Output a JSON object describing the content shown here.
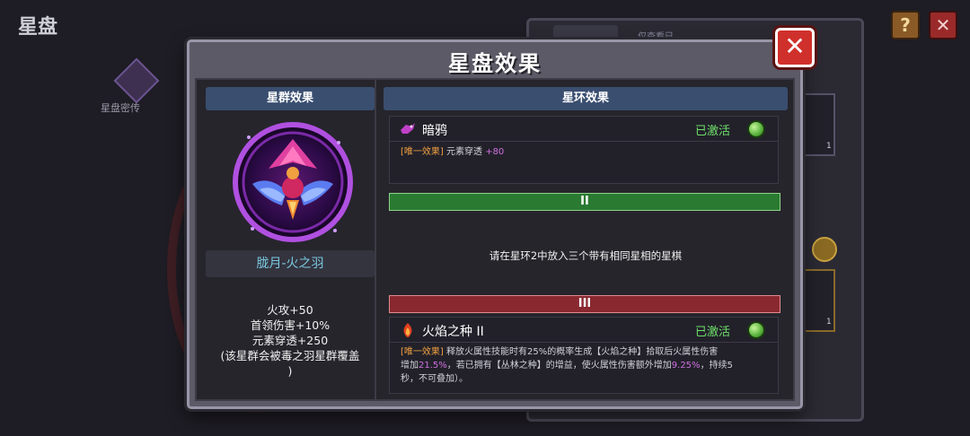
{
  "background": {
    "screen_title": "星盘",
    "help_label": "?",
    "close_label": "✕",
    "side_label": "星盘密传",
    "tab_a": "",
    "tab_b": "仅查看已",
    "slot_count_1": "1",
    "slot_count_2": "1"
  },
  "dialog": {
    "title": "星盘效果",
    "close_label": "✕",
    "left": {
      "header": "星群效果",
      "constellation_name": "胧月-火之羽",
      "bonuses": [
        "火攻+50",
        "首领伤害+10%",
        "元素穿透+250",
        "(该星群会被毒之羽星群覆盖",
        ")"
      ]
    },
    "right": {
      "header": "星环效果",
      "ring1": {
        "name": "暗鸦",
        "status": "已激活",
        "effect_tag": "[唯一效果]",
        "effect_text": "元素穿透",
        "effect_value": "+80"
      },
      "tier2_label": "II",
      "tier2_hint": "请在星环2中放入三个带有相同星相的星棋",
      "tier3_label": "III",
      "ring3": {
        "name": "火焰之种 II",
        "status": "已激活",
        "effect_tag": "[唯一效果]",
        "effect_part1": "释放火属性技能时有25%的概率生成【火焰之种】拾取后火属性伤害",
        "effect_part2": "增加",
        "effect_val1": "21.5%",
        "effect_part3": "，若已拥有【丛林之种】的增益，使火属性伤害额外增加",
        "effect_val2": "9.25%",
        "effect_part4": "，持续5",
        "effect_part5": "秒，不可叠加）。"
      }
    }
  },
  "colors": {
    "active_green": "#6ee06a",
    "tag_orange": "#f0a040",
    "value_purple": "#d070e0",
    "header_blue": "#3a4e70",
    "close_red": "#d0302c"
  },
  "icons": {
    "ring1_icon": "crow-icon",
    "ring3_icon": "flame-seed-icon",
    "status_icon": "green-orb-icon",
    "emblem": "phoenix-emblem-icon"
  }
}
